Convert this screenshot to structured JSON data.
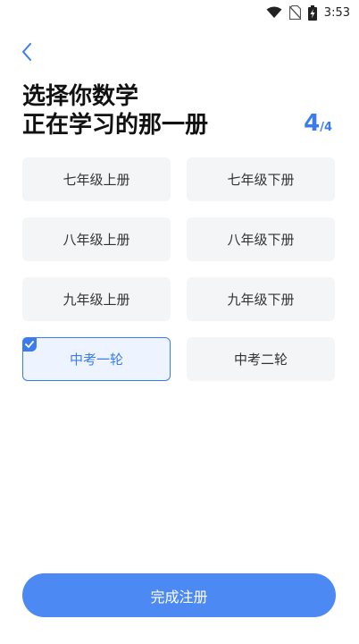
{
  "status_bar": {
    "time": "3:53",
    "icons": [
      "wifi-icon",
      "no-sim-icon",
      "battery-charging-icon"
    ]
  },
  "header": {
    "back_icon": "chevron-left-icon",
    "title_line1": "选择你数学",
    "title_line2": "正在学习的那一册",
    "step_current": "4",
    "step_total": "/4"
  },
  "options": [
    {
      "label": "七年级上册",
      "selected": false
    },
    {
      "label": "七年级下册",
      "selected": false
    },
    {
      "label": "八年级上册",
      "selected": false
    },
    {
      "label": "八年级下册",
      "selected": false
    },
    {
      "label": "九年级上册",
      "selected": false
    },
    {
      "label": "九年级下册",
      "selected": false
    },
    {
      "label": "中考一轮",
      "selected": true
    },
    {
      "label": "中考二轮",
      "selected": false
    }
  ],
  "submit_label": "完成注册",
  "colors": {
    "accent": "#3a7bef",
    "button": "#4d89f2",
    "option_bg": "#f3f5f7",
    "selected_bg": "#eef4ff"
  }
}
